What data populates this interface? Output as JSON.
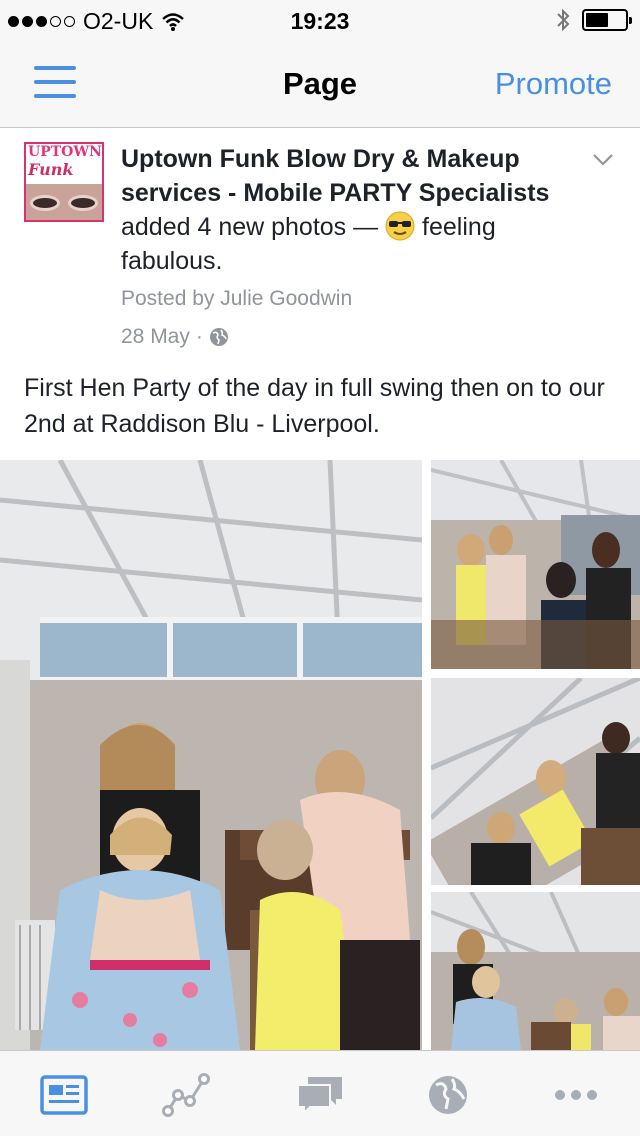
{
  "status_bar": {
    "carrier": "O2-UK",
    "time": "19:23",
    "signal_bars_filled": 3,
    "signal_bars_total": 5
  },
  "nav": {
    "title": "Page",
    "promote_label": "Promote",
    "menu_icon": "hamburger-menu-icon",
    "accent_color": "#4a90e2"
  },
  "post": {
    "page_name": "Uptown Funk Blow Dry & Makeup services  - Mobile PARTY Specialists",
    "action": "added 4 new photos",
    "feeling_prefix": "—",
    "feeling": "feeling fabulous.",
    "posted_by": "Posted by Julie Goodwin",
    "date": "28 May",
    "separator": "·",
    "caption": "First Hen Party of the day in full swing then on to our 2nd at Raddison Blu - Liverpool.",
    "avatar_text": "UPTOWN Funk"
  },
  "photos": {
    "count_shown": 4
  },
  "tabbar": {
    "tabs": [
      {
        "icon": "news-feed-icon",
        "active": true
      },
      {
        "icon": "insights-graph-icon",
        "active": false
      },
      {
        "icon": "messages-icon",
        "active": false
      },
      {
        "icon": "globe-notifications-icon",
        "active": false
      },
      {
        "icon": "more-dots-icon",
        "active": false
      }
    ]
  }
}
